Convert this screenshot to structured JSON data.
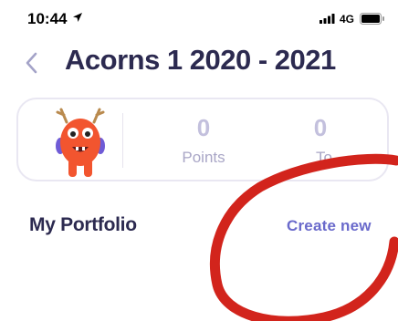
{
  "status_bar": {
    "time": "10:44",
    "network": "4G",
    "icons": [
      "location-arrow-icon",
      "signal-bars-icon",
      "battery-icon"
    ]
  },
  "nav": {
    "back_icon": "chevron-left-icon",
    "title": "Acorns 1 2020 - 2021"
  },
  "stats": {
    "points_value": "0",
    "points_label": "Points",
    "second_value": "0",
    "second_label": "To"
  },
  "portfolio": {
    "title": "My Portfolio",
    "create_label": "Create new"
  },
  "colors": {
    "title": "#2c2a50",
    "accent": "#6a6acb",
    "stat_value": "#c3c0dd",
    "stat_label": "#a9a6c6",
    "card_border": "#e9e7f2",
    "monster": "#f2552f",
    "annotation": "#d2241c"
  }
}
